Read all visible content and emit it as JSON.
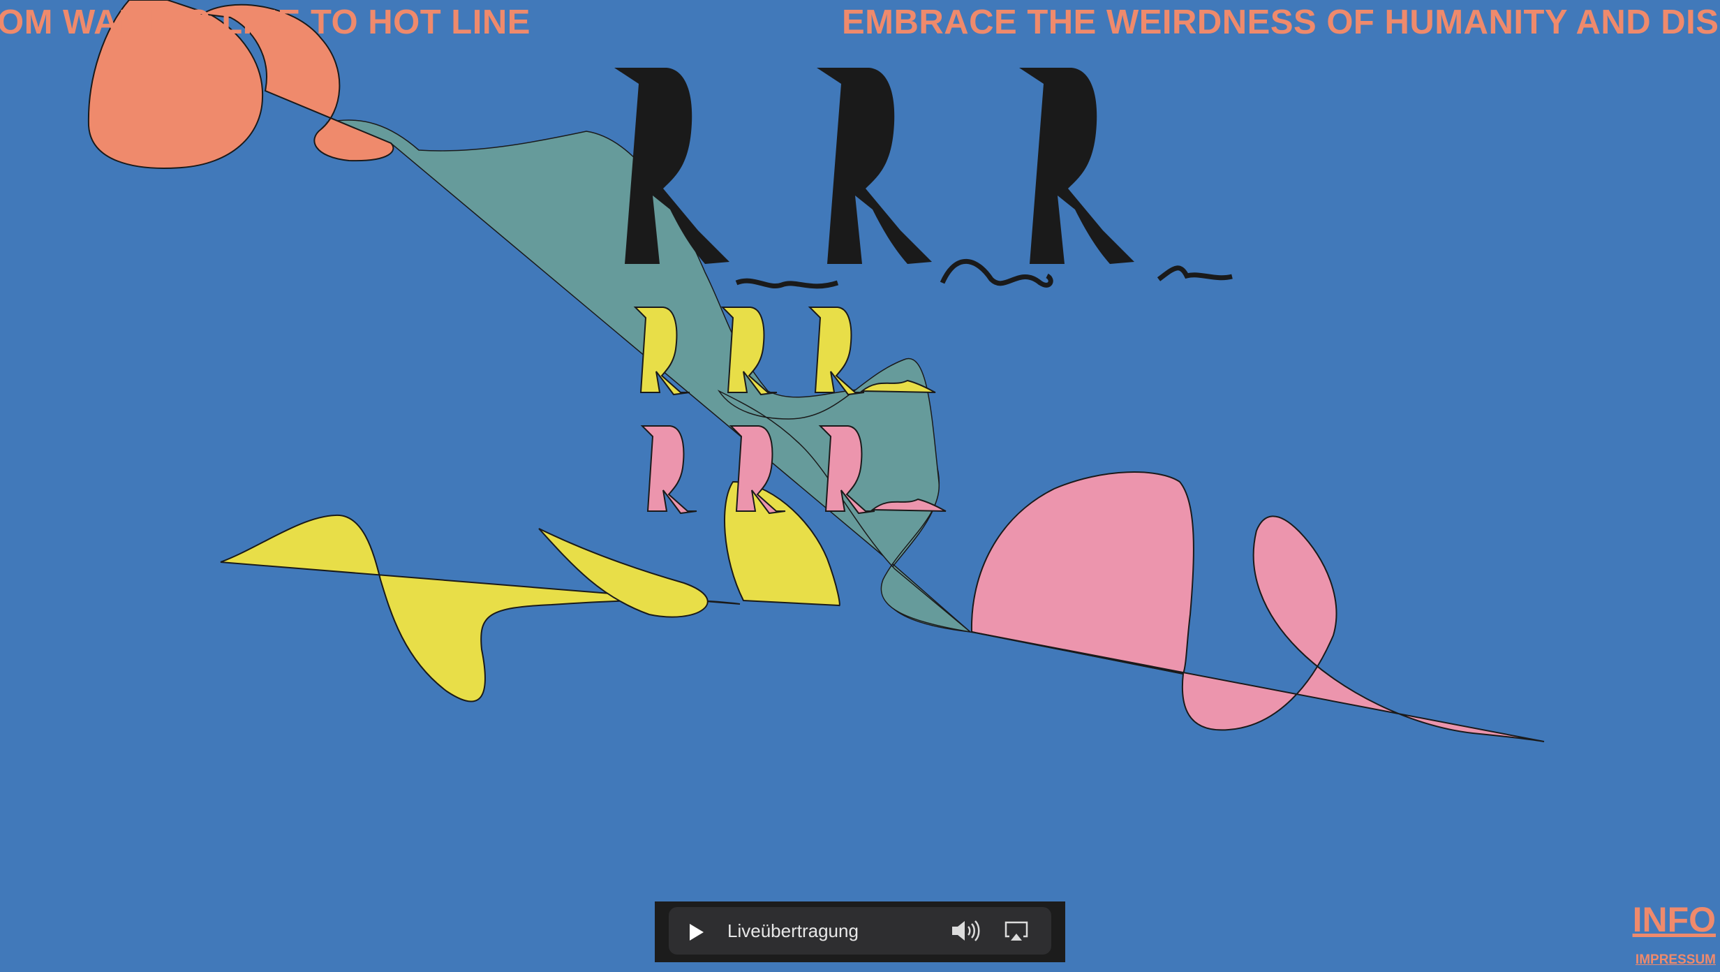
{
  "ticker": {
    "left_text": "OM WAITING LINE TO HOT LINE",
    "right_text": "EMBRACE THE WEIRDNESS OF HUMANITY AND DISM"
  },
  "logo": {
    "text": "RRR"
  },
  "player": {
    "live_label": "Liveübertragung",
    "play_icon": "play-icon",
    "volume_icon": "volume-icon",
    "airplay_icon": "airplay-icon"
  },
  "footer": {
    "info_label": "INFO",
    "impressum_label": "IMPRESSUM"
  },
  "colors": {
    "background": "#4179ba",
    "salmon": "#ef8a6c",
    "teal": "#669b9b",
    "yellow": "#e8de48",
    "pink": "#ec95ad",
    "black": "#1a1a1a"
  }
}
